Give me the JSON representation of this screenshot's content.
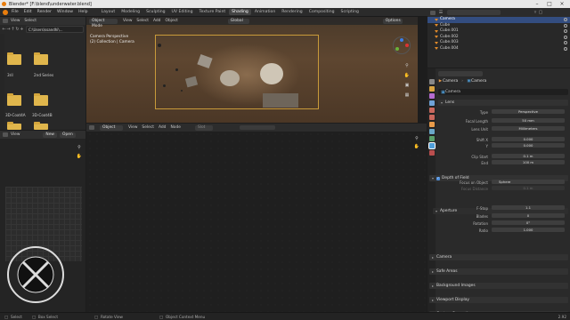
{
  "window": {
    "title": "Blender* [F:\\blend\\underwater.blend]"
  },
  "menu": [
    "File",
    "Edit",
    "Render",
    "Window",
    "Help"
  ],
  "workspaces": [
    "Layout",
    "Modeling",
    "Sculpting",
    "UV Editing",
    "Texture Paint",
    "Shading",
    "Animation",
    "Rendering",
    "Compositing",
    "Scripting"
  ],
  "active_workspace": "Shading",
  "top_right": {
    "scene": "Scene",
    "view_layer": "View Layer"
  },
  "file_browser": {
    "header": [
      "View",
      "Select"
    ],
    "path": "C:\\Users\\ssandhi\\...",
    "folders": [
      {
        "label": "3ril"
      },
      {
        "label": "2nd Series"
      },
      {
        "label": "3D-Coat4A"
      },
      {
        "label": "3D-Coat4B"
      }
    ]
  },
  "viewport": {
    "mode": "Object Mode",
    "menus": [
      "View",
      "Select",
      "Add",
      "Object"
    ],
    "orientation": "Global",
    "options": "Options",
    "camera_title": "Camera Perspective",
    "camera_sub": "(2) Collection | Camera"
  },
  "node_editor": {
    "object": "Object",
    "menus": [
      "View",
      "Select",
      "Add",
      "Node"
    ],
    "slot": "Slot"
  },
  "image_editor": {
    "view": "View",
    "new": "New",
    "open": "Open"
  },
  "outliner": {
    "items": [
      {
        "label": "Camera",
        "selected": true
      },
      {
        "label": "Cube",
        "selected": false
      },
      {
        "label": "Cube.001",
        "selected": false
      },
      {
        "label": "Cube.002",
        "selected": false
      },
      {
        "label": "Cube.003",
        "selected": false
      },
      {
        "label": "Cube.004",
        "selected": false
      }
    ]
  },
  "properties": {
    "breadcrumb_1": "Camera",
    "breadcrumb_2": "Camera",
    "data_name": "Camera",
    "lens_section": "Lens",
    "fields": [
      {
        "label": "Type",
        "value": "Perspective"
      },
      {
        "label": "Focal Length",
        "value": "50 mm"
      },
      {
        "label": "Lens Unit",
        "value": "Millimeters"
      },
      {
        "label": "Shift X",
        "value": "0.000"
      },
      {
        "label": "Y",
        "value": "0.000"
      },
      {
        "label": "Clip Start",
        "value": "0.1 m"
      },
      {
        "label": "End",
        "value": "100 m"
      }
    ],
    "dof_section": "Depth of Field",
    "focus_object_label": "Focus on Object",
    "focus_object": "Sphere",
    "focus_distance_label": "Focus Distance",
    "focus_distance": "0.1 m",
    "aperture_section": "Aperture",
    "aperture_fields": [
      {
        "label": "F-Stop",
        "value": "1.1"
      },
      {
        "label": "Blades",
        "value": "0"
      },
      {
        "label": "Rotation",
        "value": "0°"
      },
      {
        "label": "Ratio",
        "value": "1.000"
      }
    ],
    "collapsed_panels": [
      "Camera",
      "Safe Areas",
      "Background Images",
      "Viewport Display",
      "Custom Properties"
    ]
  },
  "status": {
    "select": "Select",
    "box_select": "Box Select",
    "rotate_view": "Rotate View",
    "context_menu": "Object Context Menu",
    "version": "2.92"
  },
  "colors": {
    "accent": "#e87d0d",
    "selection": "#334d80",
    "folder": "#e0b64c"
  }
}
